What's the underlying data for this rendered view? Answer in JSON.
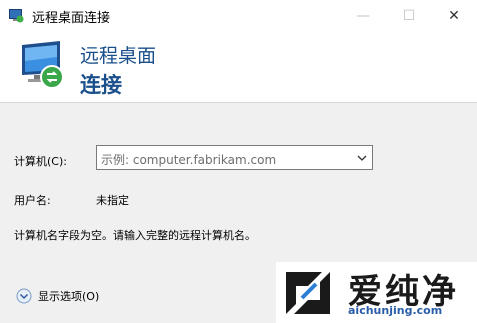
{
  "window": {
    "title": "远程桌面连接",
    "buttons": {
      "minimize": "—",
      "maximize": "☐",
      "close": "✕"
    }
  },
  "banner": {
    "line1": "远程桌面",
    "line2": "连接"
  },
  "form": {
    "computer_label": "计算机(C):",
    "computer_placeholder": "示例: computer.fabrikam.com",
    "user_label": "用户名:",
    "user_value": "未指定",
    "message": "计算机名字段为空。请输入完整的远程计算机名。"
  },
  "footer": {
    "show_options": "显示选项(O)"
  },
  "watermark": {
    "text": "爱纯净",
    "url": "aichunjing.com"
  },
  "colors": {
    "accent": "#1a4f8b",
    "content_bg": "#f0f0f0"
  }
}
